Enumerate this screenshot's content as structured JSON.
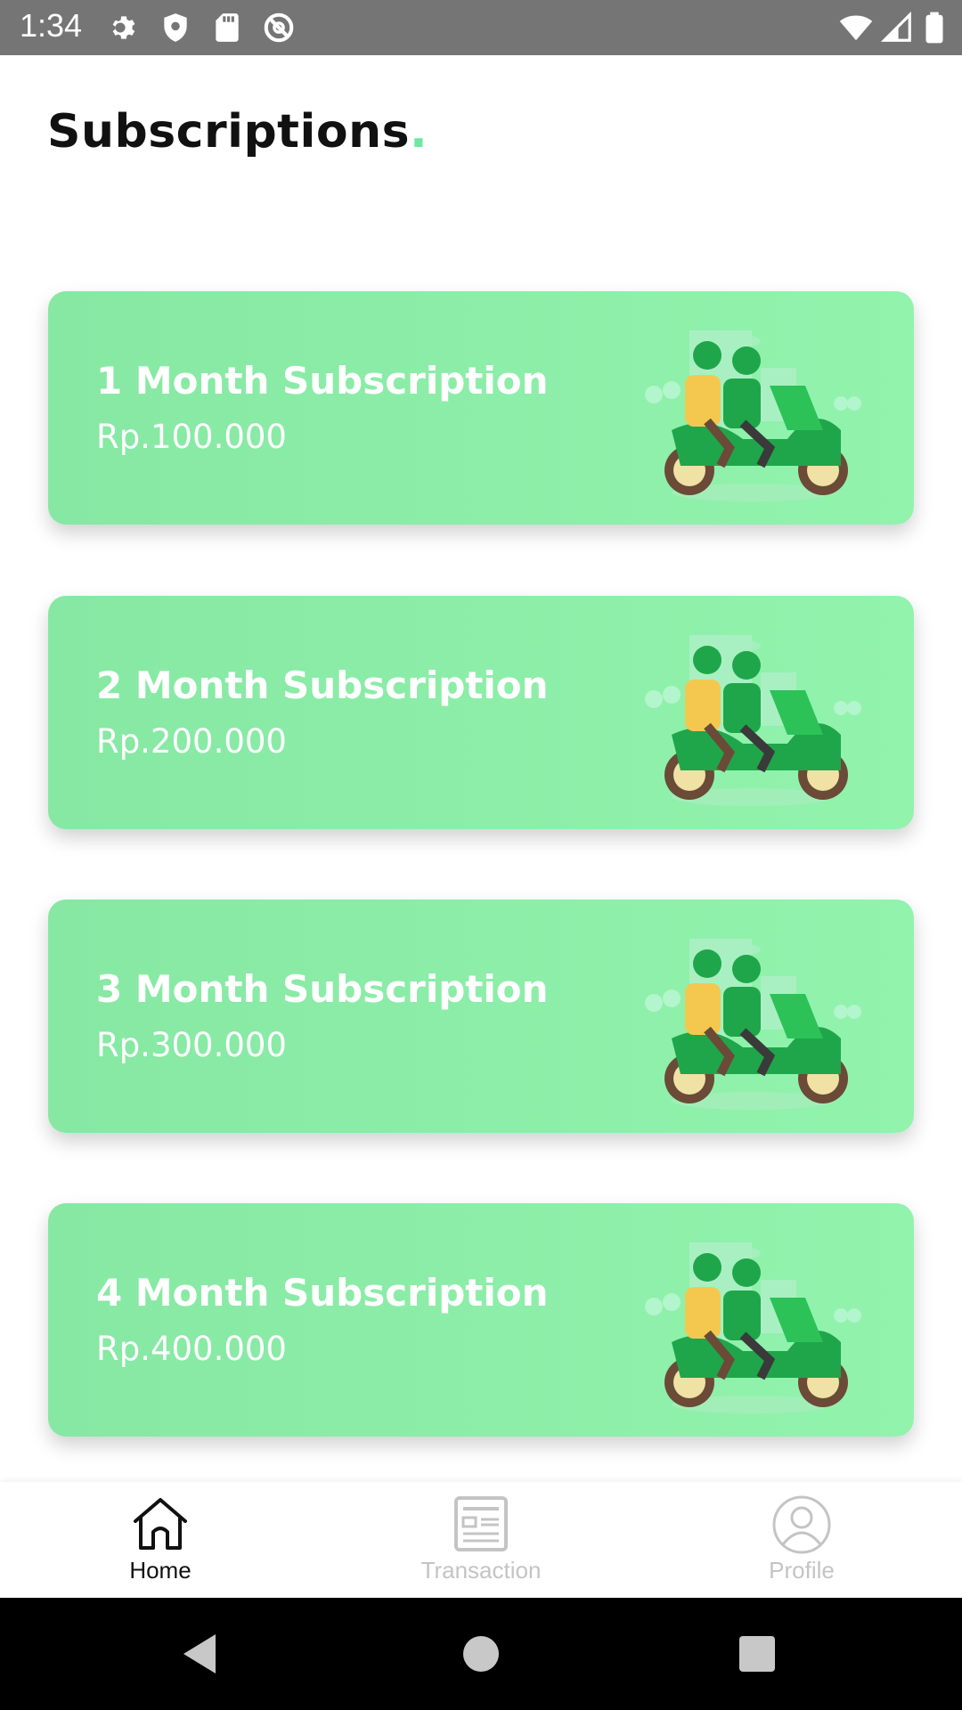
{
  "status_bar": {
    "time": "1:34",
    "icons_left": [
      "gear-icon",
      "shield-icon",
      "sd-card-icon",
      "blocked-icon"
    ],
    "icons_right": [
      "wifi-icon",
      "cell-signal-icon",
      "battery-icon"
    ]
  },
  "header": {
    "title": "Subscriptions",
    "title_dot": ".",
    "accent_color": "#6ee7a0"
  },
  "subscriptions": [
    {
      "title": "1 Month Subscription",
      "price": "Rp.100.000"
    },
    {
      "title": "2 Month Subscription",
      "price": "Rp.200.000"
    },
    {
      "title": "3 Month Subscription",
      "price": "Rp.300.000"
    },
    {
      "title": "4 Month Subscription",
      "price": "Rp.400.000"
    }
  ],
  "bottom_nav": {
    "items": [
      {
        "label": "Home",
        "icon": "home-icon",
        "active": true
      },
      {
        "label": "Transaction",
        "icon": "receipt-icon",
        "active": false
      },
      {
        "label": "Profile",
        "icon": "user-icon",
        "active": false
      }
    ]
  },
  "system_nav": [
    "back-icon",
    "home-circle-icon",
    "recents-icon"
  ],
  "colors": {
    "card_start": "#86e8a3",
    "card_end": "#92f3ad",
    "status_bar": "#757575"
  }
}
